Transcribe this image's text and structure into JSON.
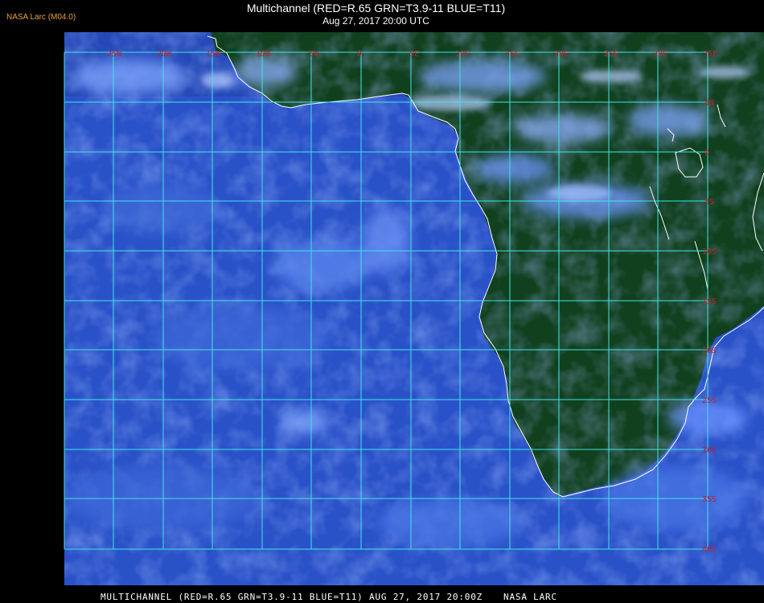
{
  "corner_label": "NASA Larc (M04.0)",
  "title": {
    "line1": "Multichannel (RED=R.65 GRN=T3.9-11 BLUE=T11)",
    "line2": "Aug 27, 2017 20:00 UTC"
  },
  "longitude_labels": [
    "25W",
    "20W",
    "15W",
    "10W",
    "5W",
    "0",
    "5E",
    "10E",
    "15E",
    "20E",
    "25E",
    "30E",
    "35E"
  ],
  "latitude_labels": [
    "5N",
    "0",
    "5S",
    "10S",
    "15S",
    "20S",
    "25S",
    "30S",
    "35S",
    "40S"
  ],
  "footer": {
    "text": "MULTICHANNEL (RED=R.65 GRN=T3.9-11 BLUE=T11) AUG 27, 2017 20:00Z",
    "credit": "NASA LARC"
  },
  "colors": {
    "grid": "#3ce6e6",
    "coastline": "#ffffff",
    "grid_labels": "#c0222e",
    "ocean": "#2a52c8",
    "land": "#11401e",
    "corner_label": "#e8a33c"
  }
}
